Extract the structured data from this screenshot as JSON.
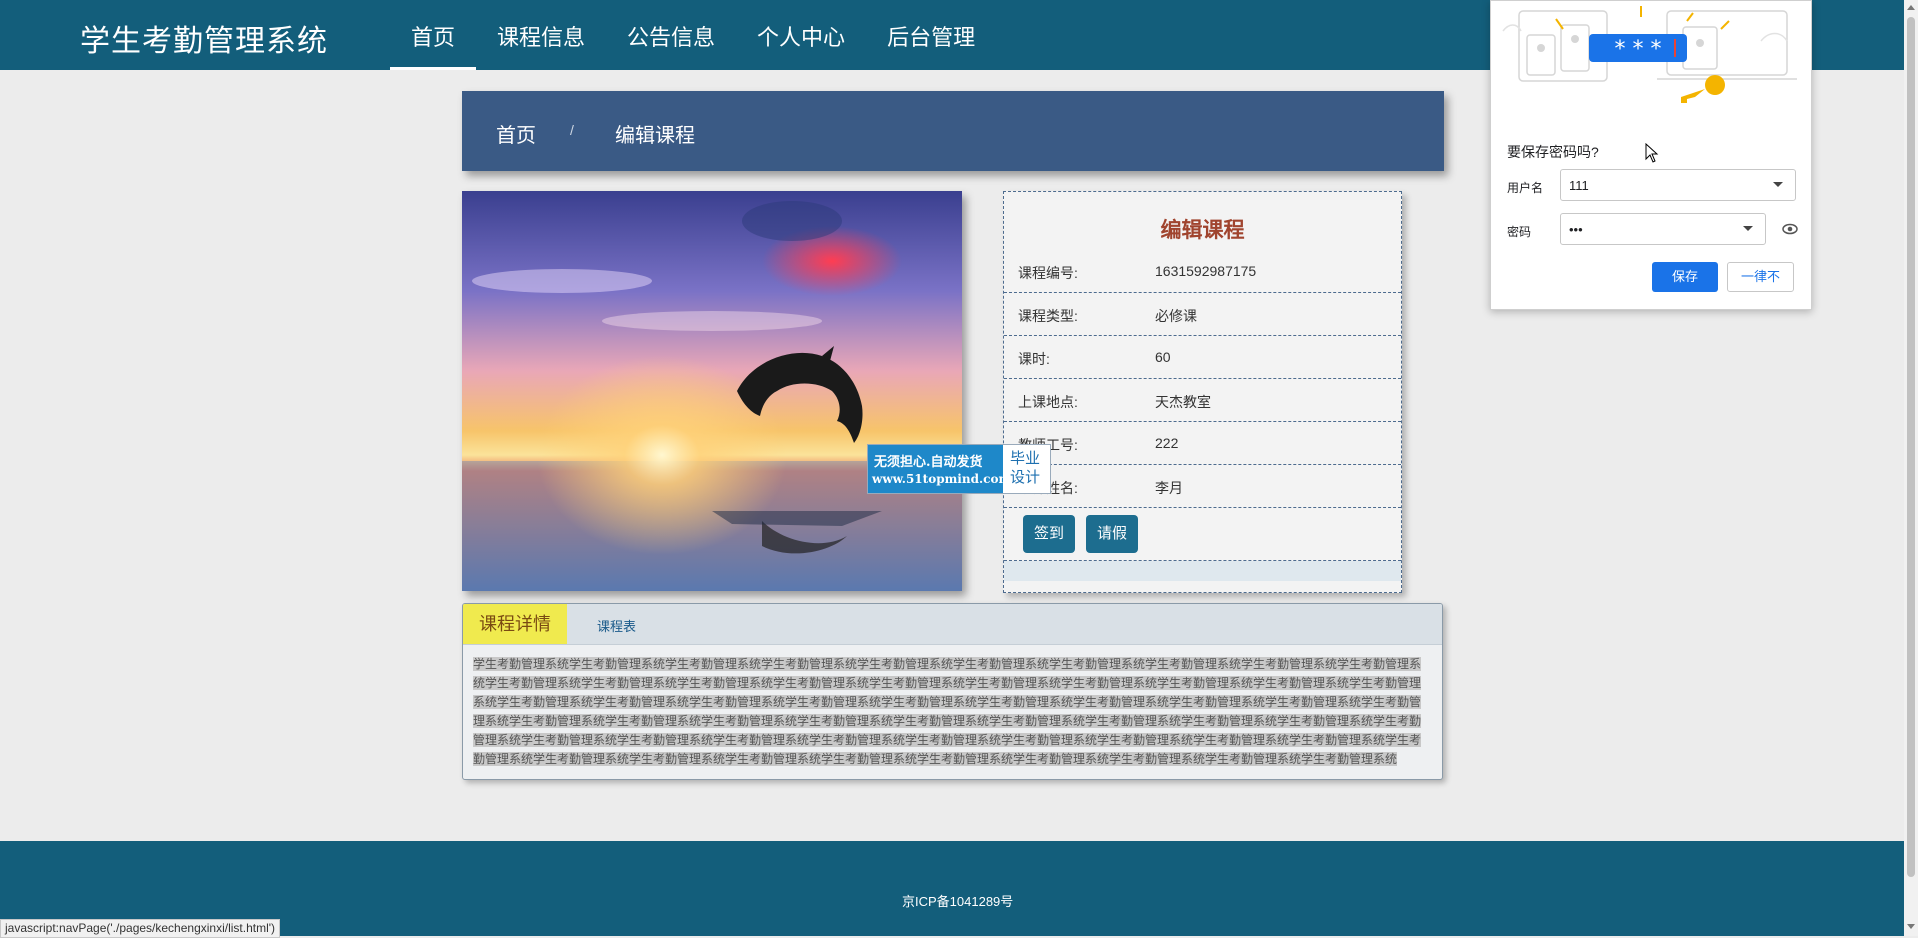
{
  "header": {
    "brand": "学生考勤管理系统",
    "nav": [
      "首页",
      "课程信息",
      "公告信息",
      "个人中心",
      "后台管理"
    ],
    "active_index": 0
  },
  "breadcrumb": {
    "home": "首页",
    "separator": "/",
    "current": "编辑课程"
  },
  "course": {
    "title": "编辑课程",
    "fields": [
      {
        "label": "课程编号:",
        "value": "1631592987175"
      },
      {
        "label": "课程类型:",
        "value": "必修课"
      },
      {
        "label": "课时:",
        "value": "60"
      },
      {
        "label": "上课地点:",
        "value": "天杰教室"
      },
      {
        "label": "教师工号:",
        "value": "222"
      },
      {
        "label": "教师姓名:",
        "value": "李月"
      }
    ],
    "buttons": {
      "sign_in": "签到",
      "leave": "请假"
    }
  },
  "watermark": {
    "line1": "无须担心.自动发货",
    "url": "www.51topmind.com",
    "side1": "毕业",
    "side2": "设计"
  },
  "detail": {
    "tabs": [
      "课程详情",
      "课程表"
    ],
    "text": "学生考勤管理系统学生考勤管理系统学生考勤管理系统学生考勤管理系统学生考勤管理系统学生考勤管理系统学生考勤管理系统学生考勤管理系统学生考勤管理系统学生考勤管理系统学生考勤管理系统学生考勤管理系统学生考勤管理系统学生考勤管理系统学生考勤管理系统学生考勤管理系统学生考勤管理系统学生考勤管理系统学生考勤管理系统学生考勤管理系统学生考勤管理系统学生考勤管理系统学生考勤管理系统学生考勤管理系统学生考勤管理系统学生考勤管理系统学生考勤管理系统学生考勤管理系统学生考勤管理系统学生考勤管理系统学生考勤管理系统学生考勤管理系统学生考勤管理系统学生考勤管理系统学生考勤管理系统学生考勤管理系统学生考勤管理系统学生考勤管理系统学生考勤管理系统学生考勤管理系统学生考勤管理系统学生考勤管理系统学生考勤管理系统学生考勤管理系统学生考勤管理系统学生考勤管理系统学生考勤管理系统学生考勤管理系统学生考勤管理系统学生考勤管理系统学生考勤管理系统学生考勤管理系统学生考勤管理系统学生考勤管理系统学生考勤管理系统学生考勤管理系统学生考勤管理系统学生考勤管理系统学生考勤管理系统"
  },
  "footer": {
    "icp": "京ICP备1041289号"
  },
  "status_bar": "javascript:navPage('./pages/kechengxinxi/list.html')",
  "password_prompt": {
    "question": "要保存密码吗?",
    "username_label": "用户名",
    "username_value": "111",
    "password_label": "密码",
    "password_value": "•••",
    "illustration_text": "* * *",
    "save": "保存",
    "never": "一律不"
  },
  "colors": {
    "header_bg": "#135e7b",
    "breadcrumb_bg": "#3a5a85",
    "button_bg": "#1d6d8f",
    "title_red": "#a0442e",
    "tab_active": "#f0ea4e"
  }
}
